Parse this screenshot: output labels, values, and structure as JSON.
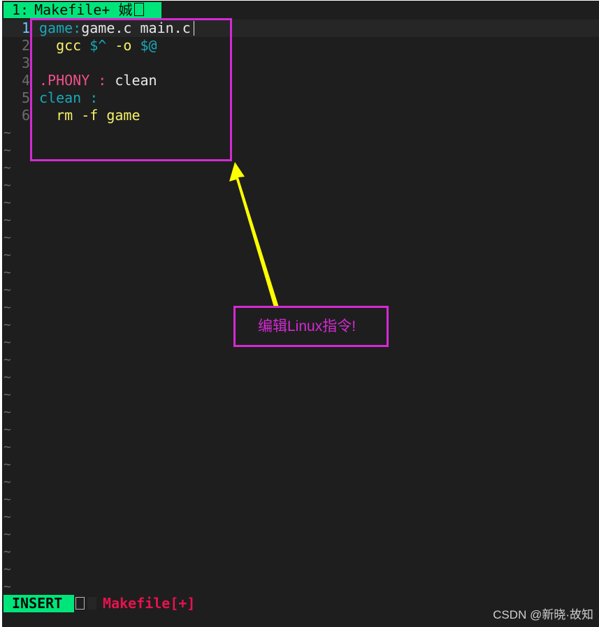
{
  "tabline": {
    "tab_number": "1:",
    "tab_title": "Makefile+ 娍"
  },
  "editor": {
    "line_numbers": [
      "1",
      "2",
      "3",
      "4",
      "5",
      "6"
    ],
    "lines": [
      [
        {
          "text": "game:",
          "style": "target"
        },
        {
          "text": "game.c main.c",
          "style": "text"
        }
      ],
      [
        {
          "text": "  gcc ",
          "style": "yellow"
        },
        {
          "text": "$^",
          "style": "teal"
        },
        {
          "text": " -o ",
          "style": "yellow"
        },
        {
          "text": "$@",
          "style": "teal"
        }
      ],
      [],
      [
        {
          "text": ".PHONY :",
          "style": "pink"
        },
        {
          "text": " clean",
          "style": "text"
        }
      ],
      [
        {
          "text": "clean :",
          "style": "teal"
        }
      ],
      [
        {
          "text": "  rm -f game",
          "style": "yellow"
        }
      ]
    ],
    "empty_line_marker": "~",
    "empty_line_count": 27
  },
  "statusline": {
    "mode": "INSERT",
    "filename": "Makefile[+]"
  },
  "annotation": {
    "label": "编辑Linux指令!",
    "color": "#d42ad4",
    "arrow_color": "#ffff00"
  },
  "watermark": "CSDN @新晓·故知",
  "colors": {
    "background": "#1e1e1e",
    "status_green": "#00e57a",
    "line_number": "#6c6c6c",
    "current_line_number": "#6fc7ff"
  }
}
